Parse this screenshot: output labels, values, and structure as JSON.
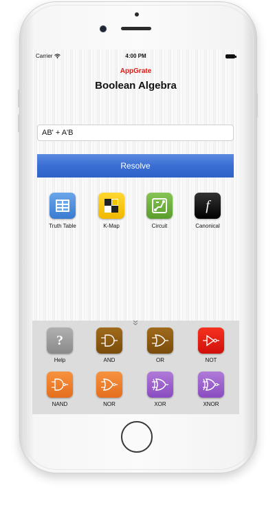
{
  "status": {
    "carrier": "Carrier",
    "time": "4:00 PM"
  },
  "app": {
    "brand": "AppGrate",
    "title": "Boolean Algebra"
  },
  "expression": {
    "value": "AB' + A'B"
  },
  "resolve_label": "Resolve",
  "tools": [
    {
      "label": "Truth Table",
      "icon": "table-icon",
      "color": "#4a90d9"
    },
    {
      "label": "K-Map",
      "icon": "kmap-icon",
      "color": "#f5c400"
    },
    {
      "label": "Circuit",
      "icon": "circuit-icon",
      "color": "#6fb33d"
    },
    {
      "label": "Canonical",
      "icon": "function-icon",
      "color": "#111111",
      "glyph": "f"
    }
  ],
  "gates": [
    {
      "label": "Help",
      "icon": "help-icon",
      "color": "#9a9a9a",
      "glyph": "?"
    },
    {
      "label": "AND",
      "icon": "and-gate-icon",
      "color": "#8b5a12"
    },
    {
      "label": "OR",
      "icon": "or-gate-icon",
      "color": "#8b5a12"
    },
    {
      "label": "NOT",
      "icon": "not-gate-icon",
      "color": "#e61c10"
    },
    {
      "label": "NAND",
      "icon": "nand-gate-icon",
      "color": "#f07e2a"
    },
    {
      "label": "NOR",
      "icon": "nor-gate-icon",
      "color": "#f07e2a"
    },
    {
      "label": "XOR",
      "icon": "xor-gate-icon",
      "color": "#9b59c9"
    },
    {
      "label": "XNOR",
      "icon": "xnor-gate-icon",
      "color": "#9b59c9"
    }
  ]
}
